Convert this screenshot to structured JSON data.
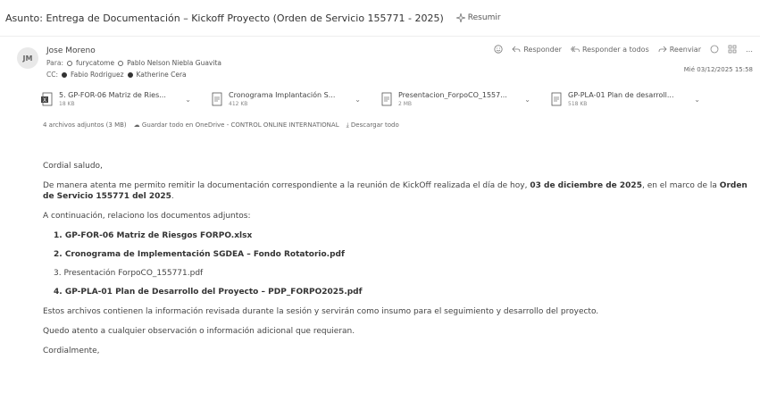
{
  "subject": "Asunto: Entrega de Documentación – Kickoff Proyecto (Orden de Servicio 155771 - 2025)",
  "summarize_label": "Resumir",
  "sender": {
    "initials": "JM",
    "name": "Jose Moreno",
    "to_label": "Para:",
    "to": [
      "furycatome",
      "Pablo Nelson Niebla Guavita"
    ],
    "cc_label": "CC:",
    "cc": [
      "Fabio Rodriguez",
      "Katherine Cera"
    ],
    "date": "Mié 03/12/2025 15:58"
  },
  "actions": {
    "reply": "Responder",
    "reply_all": "Responder a todos",
    "forward": "Reenviar",
    "more": "…"
  },
  "attachments": [
    {
      "name": "5. GP-FOR-06 Matriz de Ries...",
      "size": "18 KB"
    },
    {
      "name": "Cronograma Implantación S...",
      "size": "412 KB"
    },
    {
      "name": "Presentacion_ForpoCO_1557...",
      "size": "2 MB"
    },
    {
      "name": "GP-PLA-01 Plan de desarroll...",
      "size": "518 KB"
    }
  ],
  "attachments_summary": {
    "count": "4 archivos adjuntos (3 MB)",
    "save_onedrive": "Guardar todo en OneDrive - CONTROL ONLINE INTERNATIONAL",
    "download_all": "Descargar todo"
  },
  "body": {
    "greeting": "Cordial saludo,",
    "p1_a": "De manera atenta me permito remitir la documentación correspondiente a la reunión de KickOff realizada el día de hoy,",
    "p1_date": "03 de diciembre de 2025",
    "p1_b": ", en el marco de la",
    "p1_order": "Orden de Servicio 155771 del 2025",
    "p2": "A continuación, relaciono los documentos adjuntos:",
    "docs": [
      "1. GP-FOR-06 Matriz de Riesgos FORPO.xlsx",
      "2. Cronograma de Implementación SGDEA – Fondo Rotatorio.pdf",
      "3. Presentación ForpoCO_155771.pdf",
      "4. GP-PLA-01 Plan de Desarrollo del Proyecto – PDP_FORPO2025.pdf"
    ],
    "p3": "Estos archivos contienen la información revisada durante la sesión y servirán como insumo para el seguimiento y desarrollo del proyecto.",
    "p4": "Quedo atento a cualquier observación o información adicional que requieran.",
    "closing": "Cordialmente,"
  }
}
